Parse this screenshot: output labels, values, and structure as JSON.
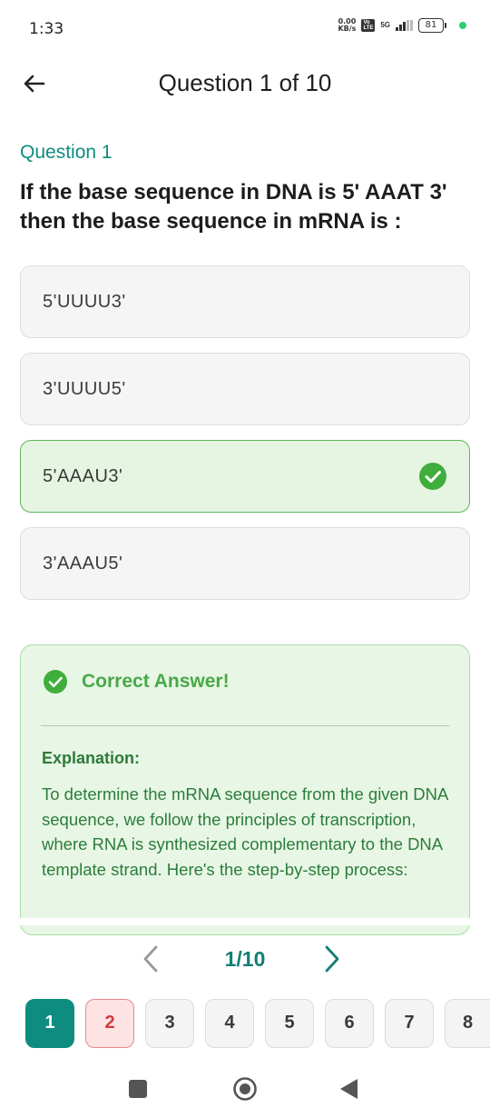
{
  "status_bar": {
    "time": "1:33",
    "net_speed_value": "0.00",
    "net_speed_unit": "KB/s",
    "volte_top": "Vo",
    "volte_bottom": "LTE",
    "network": "5G",
    "battery": "81",
    "colors": {
      "dot": "#2ecc71"
    }
  },
  "header": {
    "title": "Question 1 of 10",
    "back_icon": "arrow-left-icon"
  },
  "question": {
    "label": "Question 1",
    "text": "If the base sequence in DNA is 5' AAAT 3' then the base sequence in mRNA is :"
  },
  "options": [
    {
      "label": "5'UUUU3'",
      "state": "default"
    },
    {
      "label": "3'UUUU5'",
      "state": "default"
    },
    {
      "label": "5'AAAU3'",
      "state": "correct"
    },
    {
      "label": "3'AAAU5'",
      "state": "default"
    }
  ],
  "result": {
    "title": "Correct Answer!",
    "explanation_label": "Explanation:",
    "explanation_text": "To determine the mRNA sequence from the given DNA sequence, we follow the principles of transcription, where RNA is synthesized complementary to the DNA template strand. Here's the step-by-step process:"
  },
  "pager": {
    "indicator": "1/10"
  },
  "question_nav": [
    {
      "label": "1",
      "state": "active"
    },
    {
      "label": "2",
      "state": "wrong"
    },
    {
      "label": "3",
      "state": "default"
    },
    {
      "label": "4",
      "state": "default"
    },
    {
      "label": "5",
      "state": "default"
    },
    {
      "label": "6",
      "state": "default"
    },
    {
      "label": "7",
      "state": "default"
    },
    {
      "label": "8",
      "state": "default"
    }
  ],
  "colors": {
    "accent": "#0f8c80",
    "correct": "#48a946",
    "wrong": "#d33a3a"
  }
}
